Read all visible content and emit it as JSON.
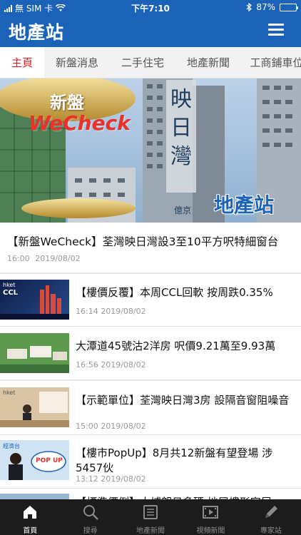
{
  "status_bar": {
    "carrier": "無 SIM 卡",
    "time": "下午7:10",
    "battery": "87%",
    "battery_level": 0.87
  },
  "header": {
    "logo": "地產站",
    "menu_icon": "hamburger-menu-icon"
  },
  "tabs": [
    {
      "label": "主頁",
      "active": true
    },
    {
      "label": "新盤消息",
      "active": false
    },
    {
      "label": "二手住宅",
      "active": false
    },
    {
      "label": "地產新聞",
      "active": false
    },
    {
      "label": "工商鋪車位",
      "active": false
    }
  ],
  "hero": {
    "badge_top": "新盤",
    "badge_main": "WeCheck",
    "building_sign": "映日灣",
    "building_sub": "億京",
    "watermark": "地產站"
  },
  "featured": {
    "title": "【新盤WeCheck】荃灣映日灣設3至10平方呎特細窗台",
    "time": "16:00",
    "date": "2019/08/02"
  },
  "news": [
    {
      "title": "【樓價反覆】本周CCL回軟 按周跌0.35%",
      "time": "16:14",
      "date": "2019/08/02",
      "thumb_text": "hket",
      "thumb_sub": "CCL"
    },
    {
      "title": "大潭道45號沽2洋房 呎價9.21萬至9.93萬",
      "time": "16:56",
      "date": "2019/08/02"
    },
    {
      "title": "【示範單位】荃灣映日灣3房 設隔音窗阻噪音",
      "time": "15:00",
      "date": "2019/08/02",
      "thumb_text": "hket"
    },
    {
      "title": "【樓市PopUp】8月共12新盤有望登場 涉5457伙",
      "time": "13:12",
      "date": "2019/08/02",
      "thumb_text": "經濟台",
      "thumb_sub": "POP UP"
    },
    {
      "title": "【標準價例】大埔朗日多碼 地層樓形家居",
      "time": "",
      "date": ""
    }
  ],
  "tab_bar": [
    {
      "label": "首頁",
      "icon": "home-icon",
      "active": true
    },
    {
      "label": "搜尋",
      "icon": "search-icon",
      "active": false
    },
    {
      "label": "地產新聞",
      "icon": "newspaper-icon",
      "active": false
    },
    {
      "label": "視頻新聞",
      "icon": "film-icon",
      "active": false
    },
    {
      "label": "專家站",
      "icon": "pen-icon",
      "active": false
    }
  ]
}
